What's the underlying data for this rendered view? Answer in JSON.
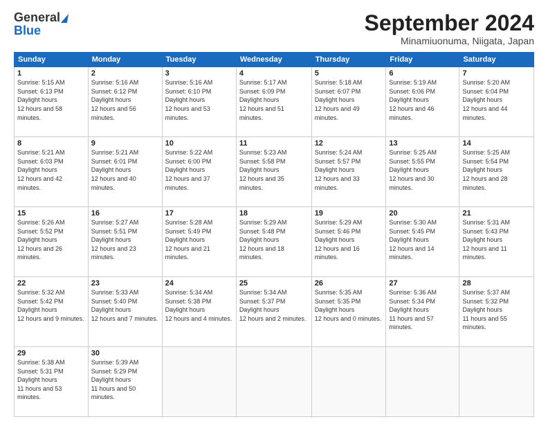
{
  "header": {
    "logo_line1": "General",
    "logo_line2": "Blue",
    "title": "September 2024",
    "subtitle": "Minamiuonuma, Niigata, Japan"
  },
  "weekdays": [
    "Sunday",
    "Monday",
    "Tuesday",
    "Wednesday",
    "Thursday",
    "Friday",
    "Saturday"
  ],
  "weeks": [
    [
      {
        "day": "1",
        "sunrise": "5:15 AM",
        "sunset": "6:13 PM",
        "daylight": "12 hours and 58 minutes."
      },
      {
        "day": "2",
        "sunrise": "5:16 AM",
        "sunset": "6:12 PM",
        "daylight": "12 hours and 56 minutes."
      },
      {
        "day": "3",
        "sunrise": "5:16 AM",
        "sunset": "6:10 PM",
        "daylight": "12 hours and 53 minutes."
      },
      {
        "day": "4",
        "sunrise": "5:17 AM",
        "sunset": "6:09 PM",
        "daylight": "12 hours and 51 minutes."
      },
      {
        "day": "5",
        "sunrise": "5:18 AM",
        "sunset": "6:07 PM",
        "daylight": "12 hours and 49 minutes."
      },
      {
        "day": "6",
        "sunrise": "5:19 AM",
        "sunset": "6:06 PM",
        "daylight": "12 hours and 46 minutes."
      },
      {
        "day": "7",
        "sunrise": "5:20 AM",
        "sunset": "6:04 PM",
        "daylight": "12 hours and 44 minutes."
      }
    ],
    [
      {
        "day": "8",
        "sunrise": "5:21 AM",
        "sunset": "6:03 PM",
        "daylight": "12 hours and 42 minutes."
      },
      {
        "day": "9",
        "sunrise": "5:21 AM",
        "sunset": "6:01 PM",
        "daylight": "12 hours and 40 minutes."
      },
      {
        "day": "10",
        "sunrise": "5:22 AM",
        "sunset": "6:00 PM",
        "daylight": "12 hours and 37 minutes."
      },
      {
        "day": "11",
        "sunrise": "5:23 AM",
        "sunset": "5:58 PM",
        "daylight": "12 hours and 35 minutes."
      },
      {
        "day": "12",
        "sunrise": "5:24 AM",
        "sunset": "5:57 PM",
        "daylight": "12 hours and 33 minutes."
      },
      {
        "day": "13",
        "sunrise": "5:25 AM",
        "sunset": "5:55 PM",
        "daylight": "12 hours and 30 minutes."
      },
      {
        "day": "14",
        "sunrise": "5:25 AM",
        "sunset": "5:54 PM",
        "daylight": "12 hours and 28 minutes."
      }
    ],
    [
      {
        "day": "15",
        "sunrise": "5:26 AM",
        "sunset": "5:52 PM",
        "daylight": "12 hours and 26 minutes."
      },
      {
        "day": "16",
        "sunrise": "5:27 AM",
        "sunset": "5:51 PM",
        "daylight": "12 hours and 23 minutes."
      },
      {
        "day": "17",
        "sunrise": "5:28 AM",
        "sunset": "5:49 PM",
        "daylight": "12 hours and 21 minutes."
      },
      {
        "day": "18",
        "sunrise": "5:29 AM",
        "sunset": "5:48 PM",
        "daylight": "12 hours and 18 minutes."
      },
      {
        "day": "19",
        "sunrise": "5:29 AM",
        "sunset": "5:46 PM",
        "daylight": "12 hours and 16 minutes."
      },
      {
        "day": "20",
        "sunrise": "5:30 AM",
        "sunset": "5:45 PM",
        "daylight": "12 hours and 14 minutes."
      },
      {
        "day": "21",
        "sunrise": "5:31 AM",
        "sunset": "5:43 PM",
        "daylight": "12 hours and 11 minutes."
      }
    ],
    [
      {
        "day": "22",
        "sunrise": "5:32 AM",
        "sunset": "5:42 PM",
        "daylight": "12 hours and 9 minutes."
      },
      {
        "day": "23",
        "sunrise": "5:33 AM",
        "sunset": "5:40 PM",
        "daylight": "12 hours and 7 minutes."
      },
      {
        "day": "24",
        "sunrise": "5:34 AM",
        "sunset": "5:38 PM",
        "daylight": "12 hours and 4 minutes."
      },
      {
        "day": "25",
        "sunrise": "5:34 AM",
        "sunset": "5:37 PM",
        "daylight": "12 hours and 2 minutes."
      },
      {
        "day": "26",
        "sunrise": "5:35 AM",
        "sunset": "5:35 PM",
        "daylight": "12 hours and 0 minutes."
      },
      {
        "day": "27",
        "sunrise": "5:36 AM",
        "sunset": "5:34 PM",
        "daylight": "11 hours and 57 minutes."
      },
      {
        "day": "28",
        "sunrise": "5:37 AM",
        "sunset": "5:32 PM",
        "daylight": "11 hours and 55 minutes."
      }
    ],
    [
      {
        "day": "29",
        "sunrise": "5:38 AM",
        "sunset": "5:31 PM",
        "daylight": "11 hours and 53 minutes."
      },
      {
        "day": "30",
        "sunrise": "5:39 AM",
        "sunset": "5:29 PM",
        "daylight": "11 hours and 50 minutes."
      },
      null,
      null,
      null,
      null,
      null
    ]
  ]
}
